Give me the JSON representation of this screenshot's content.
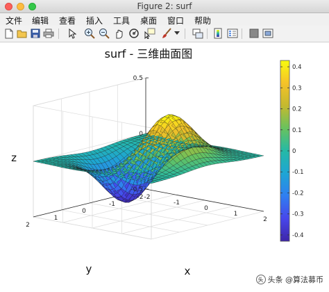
{
  "window": {
    "title": "Figure 2: surf"
  },
  "menu": [
    "文件",
    "编辑",
    "查看",
    "插入",
    "工具",
    "桌面",
    "窗口",
    "帮助"
  ],
  "toolbar": {
    "icons": [
      "new-file-icon",
      "open-folder-icon",
      "save-icon",
      "print-icon",
      "pointer-icon",
      "zoom-in-icon",
      "zoom-out-icon",
      "pan-hand-icon",
      "rotate-3d-icon",
      "data-cursor-icon",
      "brush-icon",
      "brush-dropdown-icon",
      "link-plot-icon",
      "insert-colorbar-icon",
      "insert-legend-icon",
      "hide-plot-tools-icon",
      "show-plot-tools-icon"
    ]
  },
  "plot": {
    "title": "surf - 三维曲面图",
    "zlabel": "z",
    "xlabel": "x",
    "ylabel": "y",
    "z_ticks": [
      "0.5",
      "0",
      "-0.5"
    ],
    "x_ticks": [
      "-2",
      "-1",
      "0",
      "1",
      "2"
    ],
    "y_ticks": [
      "2",
      "1",
      "0",
      "-1",
      "-2"
    ],
    "colorbar_ticks": [
      "0.4",
      "0.3",
      "0.2",
      "0.1",
      "0",
      "-0.1",
      "-0.2",
      "-0.3",
      "-0.4"
    ]
  },
  "watermark": {
    "text": "头条 @算法募币"
  },
  "chart_data": {
    "type": "surface",
    "function": "z = x * exp(-x^2 - y^2)",
    "title": "surf - 三维曲面图",
    "xlabel": "x",
    "ylabel": "y",
    "zlabel": "z",
    "xlim": [
      -2,
      2
    ],
    "ylim": [
      -2,
      2
    ],
    "zlim": [
      -0.5,
      0.5
    ],
    "colorbar_range": [
      -0.43,
      0.43
    ],
    "colormap": "parula",
    "grid": true
  }
}
